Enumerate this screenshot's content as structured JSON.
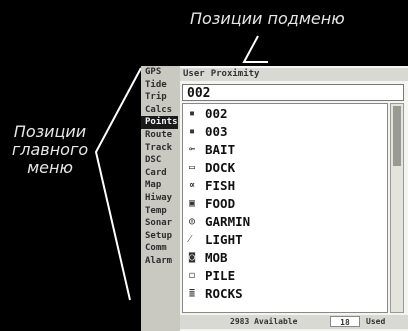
{
  "callouts": {
    "submenu": "Позиции подменю",
    "main_line1": "Позиции",
    "main_line2": "главного",
    "main_line3": "меню"
  },
  "sidebar": {
    "items": [
      "GPS",
      "Tide",
      "Trip",
      "Calcs",
      "Points",
      "Route",
      "Track",
      "DSC",
      "Card",
      "Map",
      "Hiway",
      "Temp",
      "Sonar",
      "Setup",
      "Comm",
      "Alarm"
    ],
    "selected": "Points"
  },
  "tabs": [
    "User",
    "Proximity"
  ],
  "search": {
    "value": "002"
  },
  "list": [
    {
      "icon": "square-icon",
      "glyph": "▪",
      "label": "002"
    },
    {
      "icon": "square-icon",
      "glyph": "▪",
      "label": "003"
    },
    {
      "icon": "bait-icon",
      "glyph": "⟜",
      "label": "BAIT"
    },
    {
      "icon": "dock-icon",
      "glyph": "▭",
      "label": "DOCK"
    },
    {
      "icon": "fish-icon",
      "glyph": "∝",
      "label": "FISH"
    },
    {
      "icon": "food-icon",
      "glyph": "▣",
      "label": "FOOD"
    },
    {
      "icon": "garmin-icon",
      "glyph": "◎",
      "label": "GARMIN"
    },
    {
      "icon": "light-icon",
      "glyph": "⁄",
      "label": "LIGHT"
    },
    {
      "icon": "mob-icon",
      "glyph": "◙",
      "label": "MOB"
    },
    {
      "icon": "pile-icon",
      "glyph": "◻",
      "label": "PILE"
    },
    {
      "icon": "rocks-icon",
      "glyph": "≣",
      "label": "ROCKS"
    }
  ],
  "status": {
    "available": "2983 Available",
    "used_count": "18",
    "used_label": "Used"
  },
  "colors": {
    "background": "#000000",
    "panel": "#f4f4f0",
    "selected": "#1a1a1a"
  }
}
